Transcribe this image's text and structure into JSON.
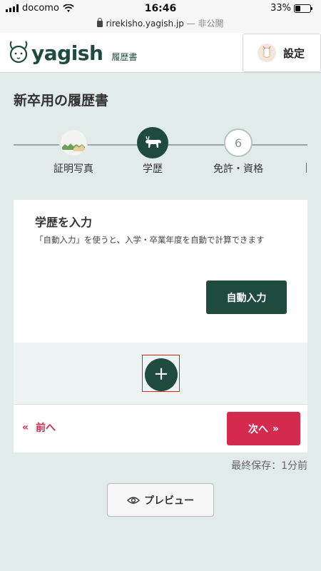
{
  "status_bar": {
    "carrier": "docomo",
    "time": "16:46",
    "battery": "33%",
    "battery_level": 0.33,
    "url": "rirekisho.yagish.jp",
    "url_suffix": "— 非公開"
  },
  "header": {
    "logo_text": "yagish",
    "logo_sub": "履歴書",
    "settings_label": "設定"
  },
  "page": {
    "title": "新卒用の履歴書"
  },
  "stepper": {
    "steps": [
      {
        "label": "証明写真",
        "state": "done"
      },
      {
        "label": "学歴",
        "state": "active"
      },
      {
        "label": "免許・資格",
        "number": "6",
        "state": "upcoming"
      }
    ]
  },
  "education": {
    "title": "学歴を入力",
    "description": "「自動入力」を使うと、入学・卒業年度を自動で計算できます",
    "auto_button": "自動入力",
    "add_button": "+"
  },
  "navigation": {
    "prev_label": "前へ",
    "prev_icon": "«",
    "next_label": "次へ",
    "next_icon": "»"
  },
  "save_status": "最終保存：1分前",
  "preview_label": "プレビュー",
  "colors": {
    "primary": "#1e4a3f",
    "accent": "#d42a4e",
    "background": "#e1ecea",
    "highlight": "#e02020"
  }
}
